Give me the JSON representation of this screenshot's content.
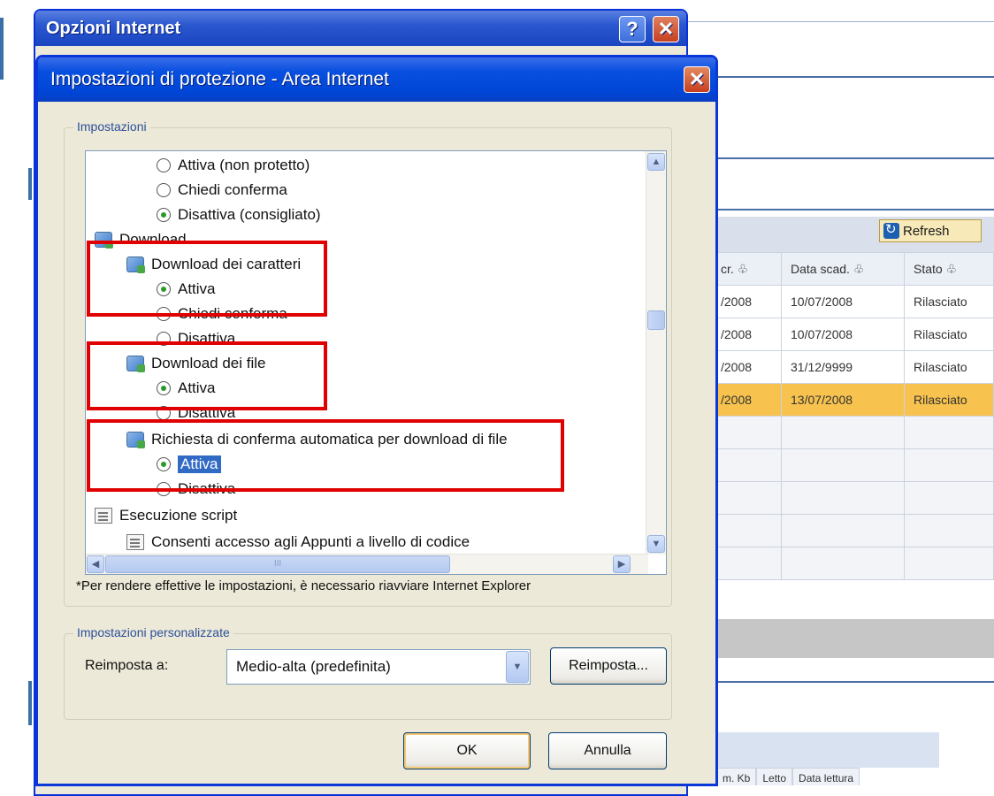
{
  "background": {
    "refresh_label": "Refresh",
    "columns": [
      "cr. ♧",
      "Data scad. ♧",
      "Stato ♧"
    ],
    "rows": [
      [
        "/2008",
        "10/07/2008",
        "Rilasciato"
      ],
      [
        "/2008",
        "10/07/2008",
        "Rilasciato"
      ],
      [
        "/2008",
        "31/12/9999",
        "Rilasciato"
      ],
      [
        "/2008",
        "13/07/2008",
        "Rilasciato"
      ]
    ],
    "bottom_columns": [
      "m. Kb",
      "Letto",
      "Data lettura"
    ]
  },
  "outer_dialog": {
    "title": "Opzioni Internet",
    "help_label": "?",
    "close_label": "✕"
  },
  "dialog": {
    "title": "Impostazioni di protezione - Area Internet",
    "close_label": "✕",
    "settings_group_label": "Impostazioni",
    "tree": [
      {
        "label": "Attiva (non protetto)",
        "kind": "radio",
        "checked": false
      },
      {
        "label": "Chiedi conferma",
        "kind": "radio",
        "checked": false
      },
      {
        "label": "Disattiva (consigliato)",
        "kind": "radio",
        "checked": true
      },
      {
        "label": "Download",
        "kind": "category"
      },
      {
        "label": "Download dei caratteri",
        "kind": "setting"
      },
      {
        "label": "Attiva",
        "kind": "radio",
        "checked": true
      },
      {
        "label": "Chiedi conferma",
        "kind": "radio",
        "checked": false
      },
      {
        "label": "Disattiva",
        "kind": "radio",
        "checked": false
      },
      {
        "label": "Download dei file",
        "kind": "setting"
      },
      {
        "label": "Attiva",
        "kind": "radio",
        "checked": true
      },
      {
        "label": "Disattiva",
        "kind": "radio",
        "checked": false
      },
      {
        "label": "Richiesta di conferma automatica per download di file",
        "kind": "setting"
      },
      {
        "label": "Attiva",
        "kind": "radio",
        "checked": true,
        "selected": true
      },
      {
        "label": "Disattiva",
        "kind": "radio",
        "checked": false
      },
      {
        "label": "Esecuzione script",
        "kind": "category"
      },
      {
        "label": "Consenti accesso agli Appunti a livello di codice",
        "kind": "setting"
      }
    ],
    "scrollbar": {
      "up": "▲",
      "down": "▼",
      "left": "◀",
      "right": "▶",
      "grip": "III"
    },
    "restart_note": "*Per rendere effettive le impostazioni, è necessario riavviare Internet Explorer",
    "custom_group_label": "Impostazioni personalizzate",
    "reset_to_label": "Reimposta a:",
    "reset_value": "Medio-alta (predefinita)",
    "reset_button": "Reimposta...",
    "ok_button": "OK",
    "cancel_button": "Annulla"
  },
  "colors": {
    "highlight_box": "#e00000",
    "selected_row": "#f7c24e",
    "xp_title_blue": "#0a50e0"
  }
}
